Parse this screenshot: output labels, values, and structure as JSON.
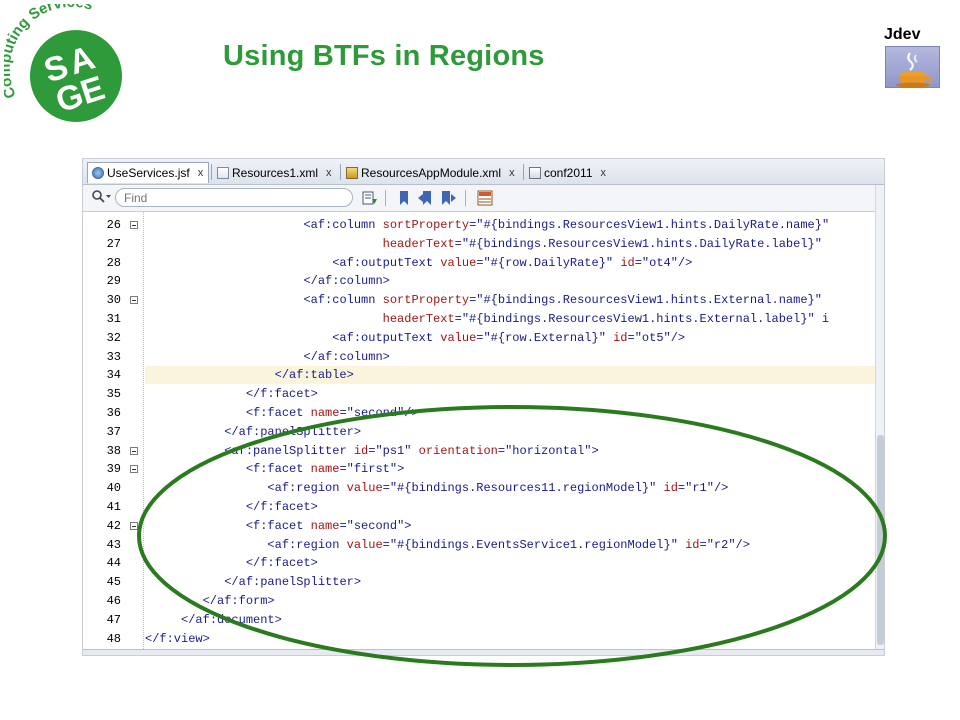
{
  "slide": {
    "title": "Using BTFs in Regions",
    "logo_ring_text": "Computing Services",
    "logo_letters": "SAGE",
    "jdev_label": "Jdev",
    "brand_color": "#2e9a3a",
    "icons": {
      "logo": "sage-logo-icon",
      "jdev": "coffee-cup-icon"
    }
  },
  "ide": {
    "tabs": [
      {
        "label": "UseServices.jsf",
        "close": "x",
        "icon": "jsf-file-icon",
        "active": true
      },
      {
        "label": "Resources1.xml",
        "close": "x",
        "icon": "xml-file-icon",
        "active": false
      },
      {
        "label": "ResourcesAppModule.xml",
        "close": "x",
        "icon": "app-module-icon",
        "active": false
      },
      {
        "label": "conf2011",
        "close": "x",
        "icon": "folder-file-icon",
        "active": false
      }
    ],
    "find": {
      "placeholder": "Find"
    },
    "toolbar_icons": [
      "search-icon",
      "pin-icon",
      "bookmark-icon",
      "prev-bookmark-icon",
      "next-bookmark-icon",
      "grid-icon"
    ],
    "highlight_color": "#fbf4dc",
    "callout_color": "#2a7a1e",
    "code_lines": [
      {
        "ln": "26",
        "fold": true,
        "hl": false,
        "segs": [
          {
            "t": "                      "
          },
          {
            "c": "t-tag",
            "t": "<af:column "
          },
          {
            "c": "t-attr",
            "t": "sortProperty"
          },
          {
            "t": "="
          },
          {
            "c": "t-val",
            "t": "\"#{bindings.ResourcesView1.hints.DailyRate.name}\""
          }
        ]
      },
      {
        "ln": "27",
        "fold": false,
        "hl": false,
        "segs": [
          {
            "t": "                                 "
          },
          {
            "c": "t-attr",
            "t": "headerText"
          },
          {
            "t": "="
          },
          {
            "c": "t-val",
            "t": "\"#{bindings.ResourcesView1.hints.DailyRate.label}\""
          }
        ]
      },
      {
        "ln": "28",
        "fold": false,
        "hl": false,
        "segs": [
          {
            "t": "                          "
          },
          {
            "c": "t-tag",
            "t": "<af:outputText "
          },
          {
            "c": "t-attr",
            "t": "value"
          },
          {
            "t": "="
          },
          {
            "c": "t-val",
            "t": "\"#{row.DailyRate}\""
          },
          {
            "t": " "
          },
          {
            "c": "t-attr",
            "t": "id"
          },
          {
            "t": "="
          },
          {
            "c": "t-val",
            "t": "\"ot4\""
          },
          {
            "c": "t-tag",
            "t": "/>"
          }
        ]
      },
      {
        "ln": "29",
        "fold": false,
        "hl": false,
        "segs": [
          {
            "t": "                      "
          },
          {
            "c": "t-tag",
            "t": "</af:column>"
          }
        ]
      },
      {
        "ln": "30",
        "fold": true,
        "hl": false,
        "segs": [
          {
            "t": "                      "
          },
          {
            "c": "t-tag",
            "t": "<af:column "
          },
          {
            "c": "t-attr",
            "t": "sortProperty"
          },
          {
            "t": "="
          },
          {
            "c": "t-val",
            "t": "\"#{bindings.ResourcesView1.hints.External.name}\""
          }
        ]
      },
      {
        "ln": "31",
        "fold": false,
        "hl": false,
        "segs": [
          {
            "t": "                                 "
          },
          {
            "c": "t-attr",
            "t": "headerText"
          },
          {
            "t": "="
          },
          {
            "c": "t-val",
            "t": "\"#{bindings.ResourcesView1.hints.External.label}\""
          },
          {
            "t": " i"
          }
        ]
      },
      {
        "ln": "32",
        "fold": false,
        "hl": false,
        "segs": [
          {
            "t": "                          "
          },
          {
            "c": "t-tag",
            "t": "<af:outputText "
          },
          {
            "c": "t-attr",
            "t": "value"
          },
          {
            "t": "="
          },
          {
            "c": "t-val",
            "t": "\"#{row.External}\""
          },
          {
            "t": " "
          },
          {
            "c": "t-attr",
            "t": "id"
          },
          {
            "t": "="
          },
          {
            "c": "t-val",
            "t": "\"ot5\""
          },
          {
            "c": "t-tag",
            "t": "/>"
          }
        ]
      },
      {
        "ln": "33",
        "fold": false,
        "hl": false,
        "segs": [
          {
            "t": "                      "
          },
          {
            "c": "t-tag",
            "t": "</af:column>"
          }
        ]
      },
      {
        "ln": "34",
        "fold": false,
        "hl": true,
        "segs": [
          {
            "t": "                  "
          },
          {
            "c": "t-tag",
            "t": "</af:table>"
          }
        ]
      },
      {
        "ln": "35",
        "fold": false,
        "hl": false,
        "segs": [
          {
            "t": "              "
          },
          {
            "c": "t-tag",
            "t": "</f:facet>"
          }
        ]
      },
      {
        "ln": "36",
        "fold": false,
        "hl": false,
        "segs": [
          {
            "t": "              "
          },
          {
            "c": "t-tag",
            "t": "<f:facet "
          },
          {
            "c": "t-attr",
            "t": "name"
          },
          {
            "t": "="
          },
          {
            "c": "t-val",
            "t": "\"second\""
          },
          {
            "c": "t-tag",
            "t": "/>"
          }
        ]
      },
      {
        "ln": "37",
        "fold": false,
        "hl": false,
        "segs": [
          {
            "t": "           "
          },
          {
            "c": "t-tag",
            "t": "</af:panelSplitter>"
          }
        ]
      },
      {
        "ln": "38",
        "fold": true,
        "hl": false,
        "segs": [
          {
            "t": "           "
          },
          {
            "c": "t-tag",
            "t": "<af:panelSplitter "
          },
          {
            "c": "t-attr",
            "t": "id"
          },
          {
            "t": "="
          },
          {
            "c": "t-val",
            "t": "\"ps1\""
          },
          {
            "t": " "
          },
          {
            "c": "t-attr",
            "t": "orientation"
          },
          {
            "t": "="
          },
          {
            "c": "t-val",
            "t": "\"horizontal\""
          },
          {
            "c": "t-tag",
            "t": ">"
          }
        ]
      },
      {
        "ln": "39",
        "fold": true,
        "hl": false,
        "segs": [
          {
            "t": "              "
          },
          {
            "c": "t-tag",
            "t": "<f:facet "
          },
          {
            "c": "t-attr",
            "t": "name"
          },
          {
            "t": "="
          },
          {
            "c": "t-val",
            "t": "\"first\""
          },
          {
            "c": "t-tag",
            "t": ">"
          }
        ]
      },
      {
        "ln": "40",
        "fold": false,
        "hl": false,
        "segs": [
          {
            "t": "                 "
          },
          {
            "c": "t-tag",
            "t": "<af:region "
          },
          {
            "c": "t-attr",
            "t": "value"
          },
          {
            "t": "="
          },
          {
            "c": "t-val",
            "t": "\"#{bindings.Resources11.regionModel}\""
          },
          {
            "t": " "
          },
          {
            "c": "t-attr",
            "t": "id"
          },
          {
            "t": "="
          },
          {
            "c": "t-val",
            "t": "\"r1\""
          },
          {
            "c": "t-tag",
            "t": "/>"
          }
        ]
      },
      {
        "ln": "41",
        "fold": false,
        "hl": false,
        "segs": [
          {
            "t": "              "
          },
          {
            "c": "t-tag",
            "t": "</f:facet>"
          }
        ]
      },
      {
        "ln": "42",
        "fold": true,
        "hl": false,
        "segs": [
          {
            "t": "              "
          },
          {
            "c": "t-tag",
            "t": "<f:facet "
          },
          {
            "c": "t-attr",
            "t": "name"
          },
          {
            "t": "="
          },
          {
            "c": "t-val",
            "t": "\"second\""
          },
          {
            "c": "t-tag",
            "t": ">"
          }
        ]
      },
      {
        "ln": "43",
        "fold": false,
        "hl": false,
        "segs": [
          {
            "t": "                 "
          },
          {
            "c": "t-tag",
            "t": "<af:region "
          },
          {
            "c": "t-attr",
            "t": "value"
          },
          {
            "t": "="
          },
          {
            "c": "t-val",
            "t": "\"#{bindings.EventsService1.regionModel}\""
          },
          {
            "t": " "
          },
          {
            "c": "t-attr",
            "t": "id"
          },
          {
            "t": "="
          },
          {
            "c": "t-val",
            "t": "\"r2\""
          },
          {
            "c": "t-tag",
            "t": "/>"
          }
        ]
      },
      {
        "ln": "44",
        "fold": false,
        "hl": false,
        "segs": [
          {
            "t": "              "
          },
          {
            "c": "t-tag",
            "t": "</f:facet>"
          }
        ]
      },
      {
        "ln": "45",
        "fold": false,
        "hl": false,
        "segs": [
          {
            "t": "           "
          },
          {
            "c": "t-tag",
            "t": "</af:panelSplitter>"
          }
        ]
      },
      {
        "ln": "46",
        "fold": false,
        "hl": false,
        "segs": [
          {
            "t": "        "
          },
          {
            "c": "t-tag",
            "t": "</af:form>"
          }
        ]
      },
      {
        "ln": "47",
        "fold": false,
        "hl": false,
        "segs": [
          {
            "t": "     "
          },
          {
            "c": "t-tag",
            "t": "</af:document>"
          }
        ]
      },
      {
        "ln": "48",
        "fold": false,
        "hl": false,
        "segs": [
          {
            "c": "t-tag",
            "t": "</f:view>"
          }
        ]
      }
    ]
  }
}
